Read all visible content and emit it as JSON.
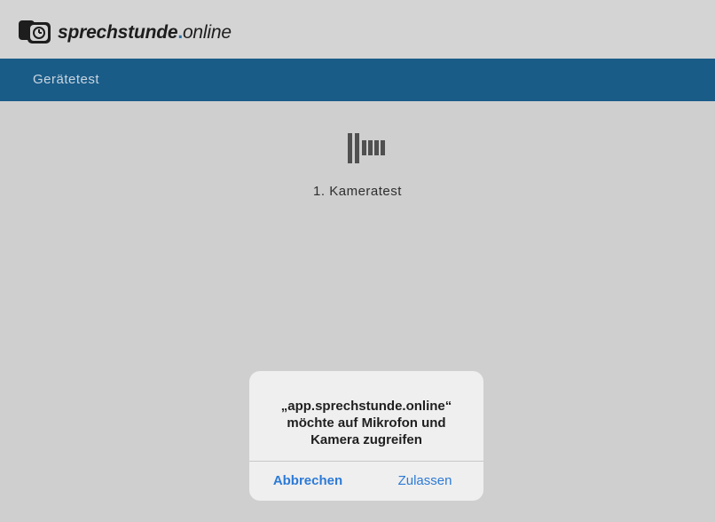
{
  "header": {
    "logo": {
      "part_bold": "sprechstunde",
      "part_dot": ".",
      "part_light": "online"
    }
  },
  "navbar": {
    "title": "Gerätetest"
  },
  "main": {
    "icon": "loading-bars-icon",
    "step_label": "1. Kameratest"
  },
  "dialog": {
    "message_lines": [
      "„app.sprechstunde.online“",
      "möchte auf Mikrofon und",
      "Kamera zugreifen"
    ],
    "cancel_label": "Abbrechen",
    "allow_label": "Zulassen"
  },
  "colors": {
    "background": "#cfcfcf",
    "navbar": "#1a5c88",
    "dialog": "#efefef",
    "ios_blue": "#2c7ad6"
  }
}
